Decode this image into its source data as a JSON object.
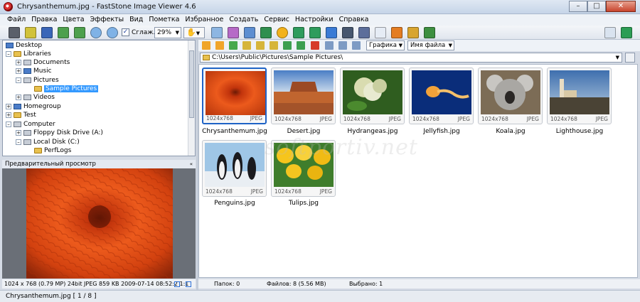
{
  "window": {
    "title": "Chrysanthemum.jpg  -  FastStone Image Viewer 4.6"
  },
  "menu": [
    "Файл",
    "Правка",
    "Цвета",
    "Эффекты",
    "Вид",
    "Пометка",
    "Избранное",
    "Создать",
    "Сервис",
    "Настройки",
    "Справка"
  ],
  "toolbar": {
    "smooth_label": "Сглаж.",
    "smooth_checked": true,
    "zoom_value": "29%"
  },
  "tree": [
    {
      "label": "Desktop"
    },
    {
      "label": "Libraries"
    },
    {
      "label": "Documents"
    },
    {
      "label": "Music"
    },
    {
      "label": "Pictures"
    },
    {
      "label": "Sample Pictures",
      "selected": true
    },
    {
      "label": "Videos"
    },
    {
      "label": "Homegroup"
    },
    {
      "label": "Test"
    },
    {
      "label": "Computer"
    },
    {
      "label": "Floppy Disk Drive (A:)"
    },
    {
      "label": "Local Disk (C:)"
    },
    {
      "label": "PerfLogs"
    }
  ],
  "preview": {
    "header": "Предварительный просмотр"
  },
  "left_status": "1024 x 768 (0.79 MP)   24bit   JPEG    859 KB   2009-07-14 08:52:2   1:1",
  "browser": {
    "view_combo": "Графика",
    "sort_combo": "Имя файла",
    "path": "C:\\Users\\Public\\Pictures\\Sample Pictures\\"
  },
  "thumbnails": [
    {
      "name": "Chrysanthemum.jpg",
      "dims": "1024x768",
      "format": "JPEG",
      "selected": true
    },
    {
      "name": "Desert.jpg",
      "dims": "1024x768",
      "format": "JPEG"
    },
    {
      "name": "Hydrangeas.jpg",
      "dims": "1024x768",
      "format": "JPEG"
    },
    {
      "name": "Jellyfish.jpg",
      "dims": "1024x768",
      "format": "JPEG"
    },
    {
      "name": "Koala.jpg",
      "dims": "1024x768",
      "format": "JPEG"
    },
    {
      "name": "Lighthouse.jpg",
      "dims": "1024x768",
      "format": "JPEG"
    },
    {
      "name": "Penguins.jpg",
      "dims": "1024x768",
      "format": "JPEG"
    },
    {
      "name": "Tulips.jpg",
      "dims": "1024x768",
      "format": "JPEG"
    }
  ],
  "watermark": "softportiv.net",
  "status": {
    "folders": "Папок: 0",
    "files": "Файлов: 8 (5.56 MB)",
    "selected": "Выбрано: 1"
  },
  "bottom_status": "Chrysanthemum.jpg [ 1 / 8 ]",
  "colors": {
    "selection": "#3399ff",
    "selected_border": "#1f63c6",
    "title_bar": "#c6d5e8"
  }
}
